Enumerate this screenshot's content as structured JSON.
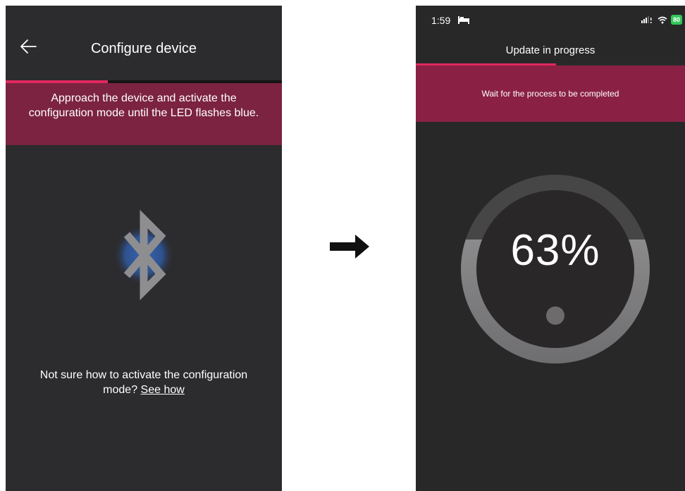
{
  "left": {
    "title": "Configure device",
    "progress_fraction": 0.37,
    "banner_line1": "Approach the device and activate the",
    "banner_line2": "configuration mode until the LED flashes blue.",
    "help_line1": "Not sure how to activate the configuration",
    "help_line2": "mode?",
    "help_link": "See how",
    "colors": {
      "accent": "#e0285f",
      "banner": "#7b2340",
      "background": "#2c2b2d",
      "bluetooth_glow": "#2f5fb0"
    }
  },
  "right": {
    "status_time": "1:59",
    "battery": "80",
    "title": "Update in progress",
    "progress_fraction": 0.52,
    "banner": "Wait for the process to be completed",
    "gauge_value": "63%",
    "colors": {
      "accent": "#e0285f",
      "banner": "#8a2144",
      "background": "#282829",
      "battery": "#33c75a"
    }
  }
}
